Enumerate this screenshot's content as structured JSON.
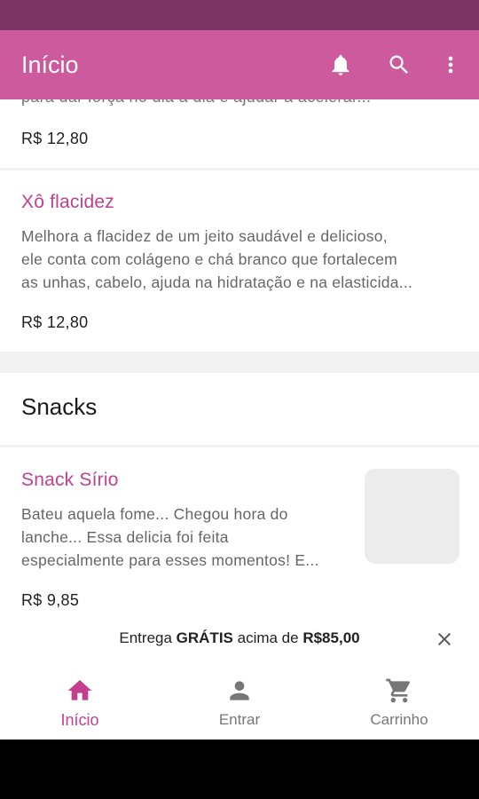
{
  "app_bar": {
    "title": "Início",
    "icons": [
      "bell-icon",
      "search-icon",
      "more-vert-icon"
    ]
  },
  "colors": {
    "status_bar": "#7a3562",
    "app_bar": "#cc5a9c",
    "accent": "#c2408d"
  },
  "products": [
    {
      "desc_clipped": "para dar força no dia a dia e ajudar a acelerar...",
      "price": "R$ 12,80"
    },
    {
      "name": "Xô flacidez",
      "desc_lines": [
        "Melhora a flacidez de um jeito saudável e delicioso,",
        "ele conta com colágeno e chá branco que fortalecem",
        "as unhas, cabelo, ajuda na hidratação e na elasticida..."
      ],
      "price": "R$ 12,80"
    }
  ],
  "section": {
    "title": "Snacks"
  },
  "snack": {
    "name": "Snack Sírio",
    "desc_lines": [
      "Bateu aquela fome... Chegou hora do",
      "lanche... Essa delicia foi feita",
      "especialmente para esses momentos! E..."
    ],
    "price": "R$ 9,85"
  },
  "banner": {
    "text_before": "Entrega ",
    "text_bold": "GRÁTIS",
    "text_middle": " acima de ",
    "text_amount": "R$85,00"
  },
  "bottom_nav": [
    {
      "label": "Início",
      "icon": "home-icon",
      "active": true
    },
    {
      "label": "Entrar",
      "icon": "person-icon",
      "active": false
    },
    {
      "label": "Carrinho",
      "icon": "cart-icon",
      "active": false
    }
  ]
}
